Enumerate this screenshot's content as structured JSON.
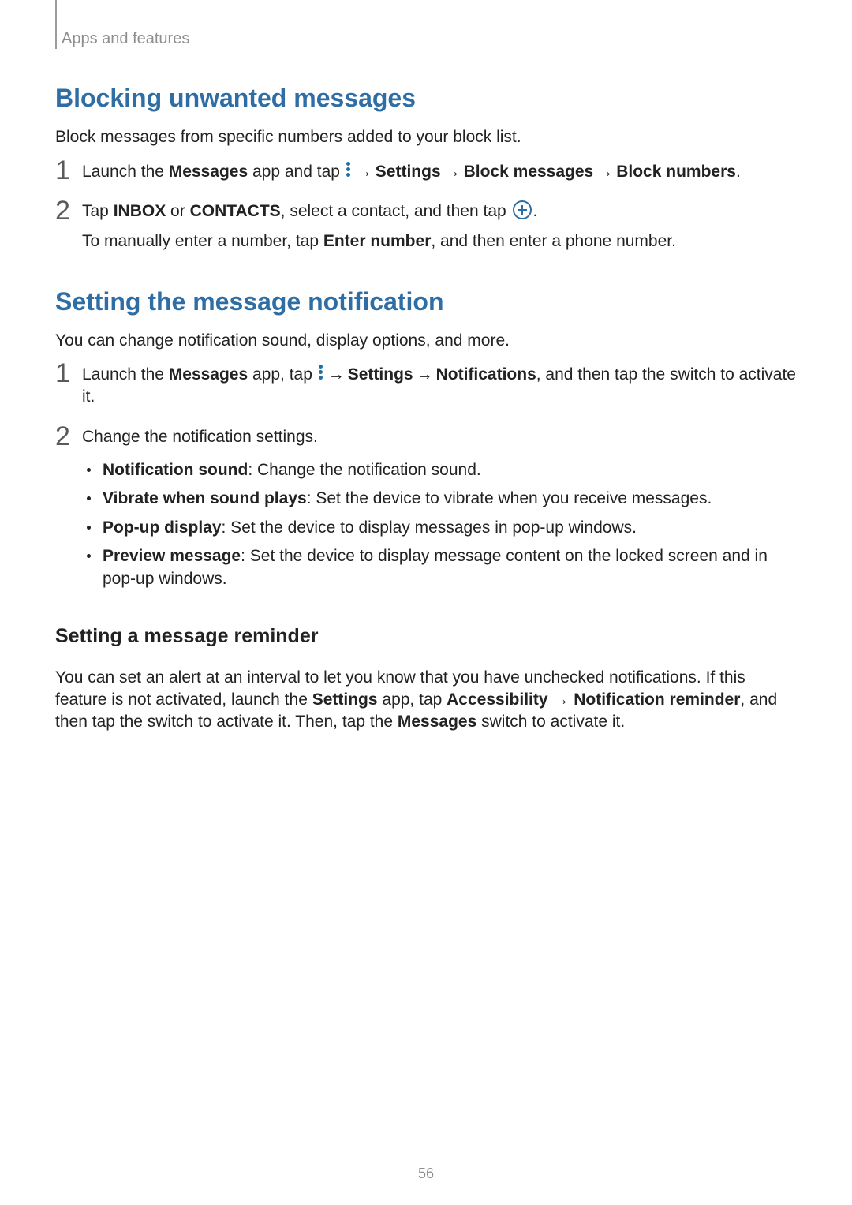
{
  "breadcrumb": "Apps and features",
  "blocking": {
    "heading": "Blocking unwanted messages",
    "intro": "Block messages from specific numbers added to your block list.",
    "steps": [
      {
        "num": "1",
        "pre": "Launch the ",
        "app": "Messages",
        "mid1": " app and tap ",
        "path1": "Settings",
        "path2": "Block messages",
        "path3": "Block numbers",
        "end": "."
      },
      {
        "num": "2",
        "pre": "Tap ",
        "t1": "INBOX",
        "or": " or ",
        "t2": "CONTACTS",
        "mid": ", select a contact, and then tap ",
        "end": ".",
        "sub_pre": "To manually enter a number, tap ",
        "sub_bold": "Enter number",
        "sub_end": ", and then enter a phone number."
      }
    ]
  },
  "notification": {
    "heading": "Setting the message notification",
    "intro": "You can change notification sound, display options, and more.",
    "steps": [
      {
        "num": "1",
        "pre": "Launch the ",
        "app": "Messages",
        "mid1": " app, tap ",
        "path1": "Settings",
        "path2": "Notifications",
        "end": ", and then tap the switch to activate it."
      },
      {
        "num": "2",
        "text": "Change the notification settings.",
        "opts": [
          {
            "t": "Notification sound",
            "d": ": Change the notification sound."
          },
          {
            "t": "Vibrate when sound plays",
            "d": ": Set the device to vibrate when you receive messages."
          },
          {
            "t": "Pop-up display",
            "d": ": Set the device to display messages in pop-up windows."
          },
          {
            "t": "Preview message",
            "d": ": Set the device to display message content on the locked screen and in pop-up windows."
          }
        ]
      }
    ]
  },
  "reminder": {
    "heading": "Setting a message reminder",
    "p_pre": "You can set an alert at an interval to let you know that you have unchecked notifications. If this feature is not activated, launch the ",
    "b1": "Settings",
    "p_mid1": " app, tap ",
    "b2": "Accessibility",
    "arrow": " → ",
    "b3": "Notification reminder",
    "p_mid2": ", and then tap the switch to activate it. Then, tap the ",
    "b4": "Messages",
    "p_end": " switch to activate it."
  },
  "arrow_glyph": "→",
  "page_number": "56"
}
